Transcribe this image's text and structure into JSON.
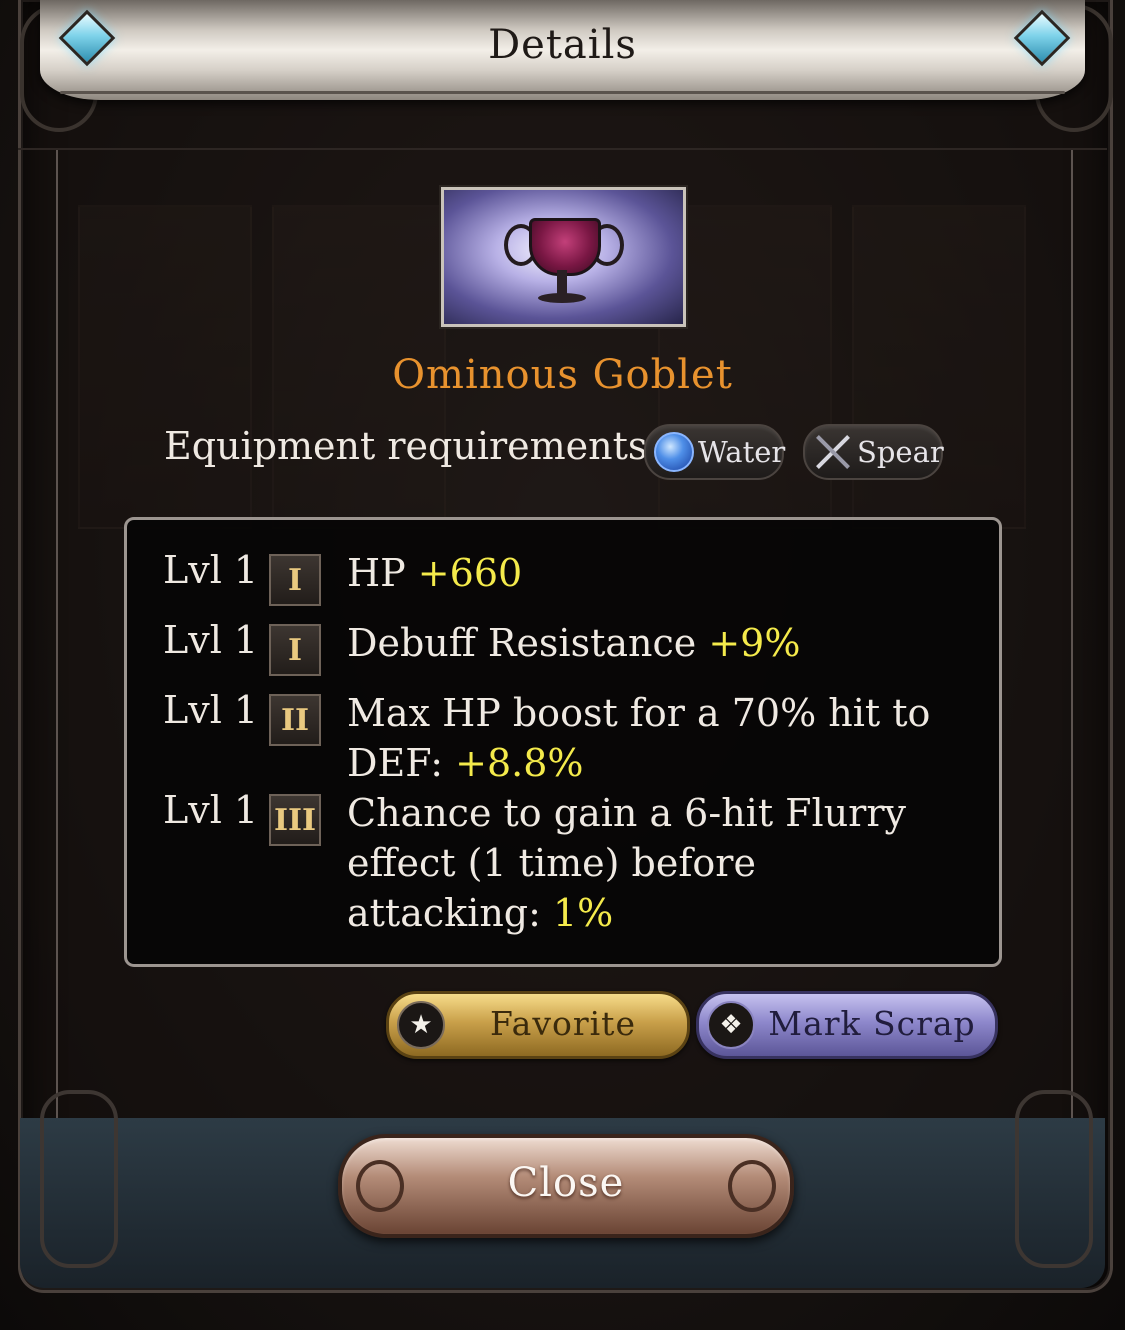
{
  "header": {
    "title": "Details"
  },
  "item": {
    "name": "Ominous Goblet",
    "image_icon": "goblet-image"
  },
  "requirements": {
    "label": "Equipment requirements:",
    "chips": [
      {
        "label": "Water",
        "icon": "water-element-icon"
      },
      {
        "label": "Spear",
        "icon": "spear-weapon-icon"
      }
    ]
  },
  "stats": [
    {
      "level": "Lvl 1",
      "tier": "I",
      "text": "HP ",
      "value": "+660"
    },
    {
      "level": "Lvl 1",
      "tier": "I",
      "text": "Debuff Resistance ",
      "value": "+9%"
    },
    {
      "level": "Lvl 1",
      "tier": "II",
      "text": "Max HP boost for a 70% hit to DEF: ",
      "value": "+8.8%"
    },
    {
      "level": "Lvl 1",
      "tier": "III",
      "text": "Chance to gain a 6-hit Flurry effect (1 time) before attacking: ",
      "value": "1%"
    }
  ],
  "actions": {
    "favorite_label": "Favorite",
    "favorite_icon": "★",
    "scrap_label": "Mark Scrap",
    "scrap_icon": "❖"
  },
  "footer": {
    "close_label": "Close"
  },
  "colors": {
    "item_name": "#e8922e",
    "stat_value": "#f4ea4b",
    "favorite_button": "#c9a04a",
    "scrap_button": "#8e88cc"
  }
}
